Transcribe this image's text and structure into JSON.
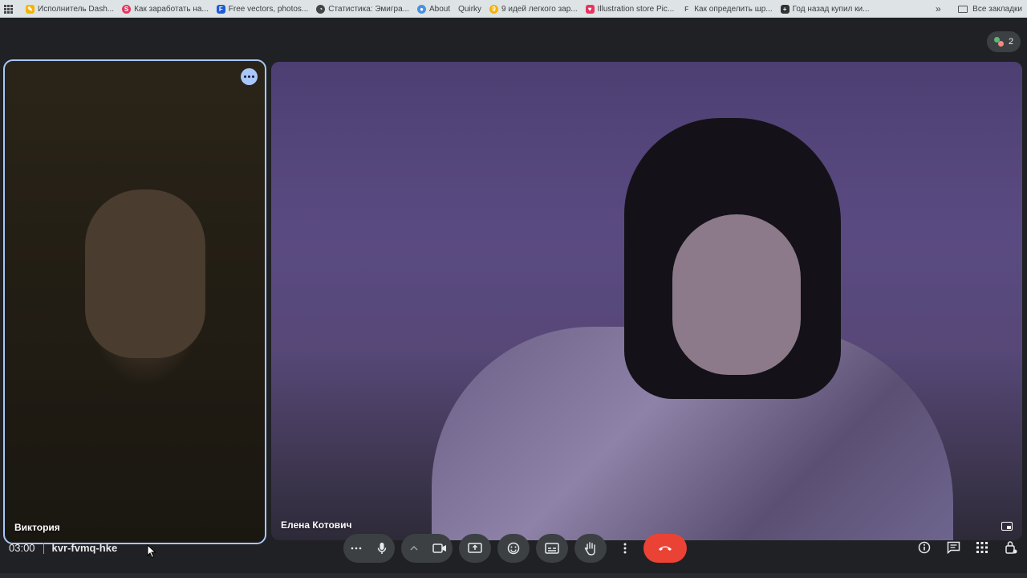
{
  "bookmarks": {
    "items": [
      {
        "label": "Исполнитель Dash...",
        "icon": "pencil-icon",
        "color": "#f4b400"
      },
      {
        "label": "Как заработать на...",
        "icon": "s-logo-icon",
        "color": "#e8335d"
      },
      {
        "label": "Free vectors, photos...",
        "icon": "f-logo-icon",
        "color": "#1e5bd6"
      },
      {
        "label": "Статистика: Эмигра...",
        "icon": "chart-icon",
        "color": "#444444"
      },
      {
        "label": "About",
        "icon": "globe-icon",
        "color": "#4a90e2"
      },
      {
        "label": "Quirky",
        "icon": "",
        "color": ""
      },
      {
        "label": "9 идей легкого зар...",
        "icon": "lightbulb-icon",
        "color": "#f4b400"
      },
      {
        "label": "Illustration store Pic...",
        "icon": "heart-icon",
        "color": "#e8335d"
      },
      {
        "label": "Как определить шр...",
        "icon": "f-letter-icon",
        "color": "#555555"
      },
      {
        "label": "Год назад купил ки...",
        "icon": "plus-square-icon",
        "color": "#333333"
      }
    ],
    "more": "»",
    "all_bookmarks": "Все закладки"
  },
  "participants_count": "2",
  "tiles": [
    {
      "name": "Виктория"
    },
    {
      "name": "Елена Котович"
    }
  ],
  "meeting": {
    "time": "03:00",
    "code": "kvr-fvmq-hke"
  },
  "colors": {
    "accent_border": "#a8c7fa",
    "hangup": "#ea4335",
    "control_bg": "#3c4043",
    "background": "#202124"
  }
}
